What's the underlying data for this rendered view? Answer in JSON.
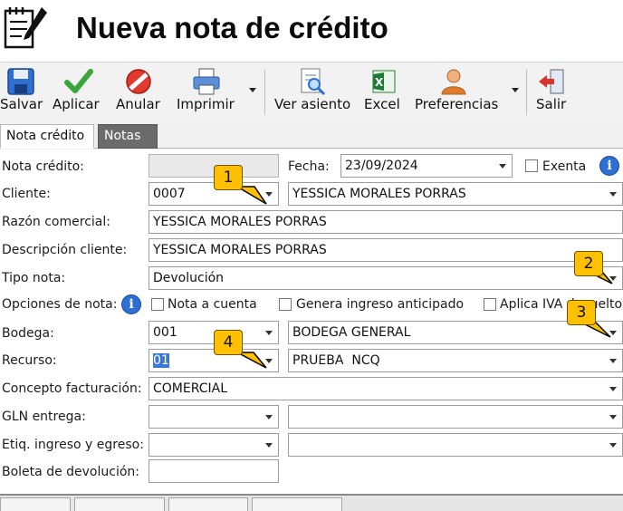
{
  "window": {
    "title": "Nueva nota de crédito"
  },
  "toolbar": {
    "salvar": "Salvar",
    "aplicar": "Aplicar",
    "anular": "Anular",
    "imprimir": "Imprimir",
    "ver_asiento": "Ver asiento",
    "excel": "Excel",
    "preferencias": "Preferencias",
    "salir": "Salir"
  },
  "tabs": [
    {
      "label": "Nota crédito",
      "active": true
    },
    {
      "label": "Notas",
      "active": false
    }
  ],
  "form": {
    "nota_credito": {
      "label": "Nota crédito:",
      "value": ""
    },
    "fecha": {
      "label": "Fecha:",
      "value": "23/09/2024"
    },
    "exenta": {
      "label": "Exenta",
      "checked": false
    },
    "cliente": {
      "label": "Cliente:",
      "code": "0007",
      "name": "YESSICA MORALES PORRAS"
    },
    "razon_comercial": {
      "label": "Razón comercial:",
      "value": "YESSICA MORALES PORRAS"
    },
    "descripcion_cliente": {
      "label": "Descripción cliente:",
      "value": "YESSICA MORALES PORRAS"
    },
    "tipo_nota": {
      "label": "Tipo nota:",
      "value": "Devolución"
    },
    "opciones_nota": {
      "label": "Opciones de nota:",
      "nota_a_cuenta": "Nota a cuenta",
      "genera_ingreso": "Genera ingreso anticipado",
      "aplica_iva": "Aplica IVA devuelto"
    },
    "bodega": {
      "label": "Bodega:",
      "code": "001",
      "name": "BODEGA GENERAL"
    },
    "recurso": {
      "label": "Recurso:",
      "code": "01",
      "name": "PRUEBA  NCQ"
    },
    "concepto_facturacion": {
      "label": "Concepto facturación:",
      "value": "COMERCIAL"
    },
    "gln_entrega": {
      "label": "GLN entrega:",
      "code": "",
      "name": ""
    },
    "etiq_ingreso_egreso": {
      "label": "Etiq. ingreso y egreso:",
      "code": "",
      "name": ""
    },
    "boleta_devolucion": {
      "label": "Boleta de devolución:",
      "value": ""
    }
  },
  "callouts": [
    "1",
    "2",
    "3",
    "4"
  ],
  "colors": {
    "callout_fill": "#ffc000",
    "info_blue": "#2d6fd2",
    "selection": "#3a78d8"
  }
}
